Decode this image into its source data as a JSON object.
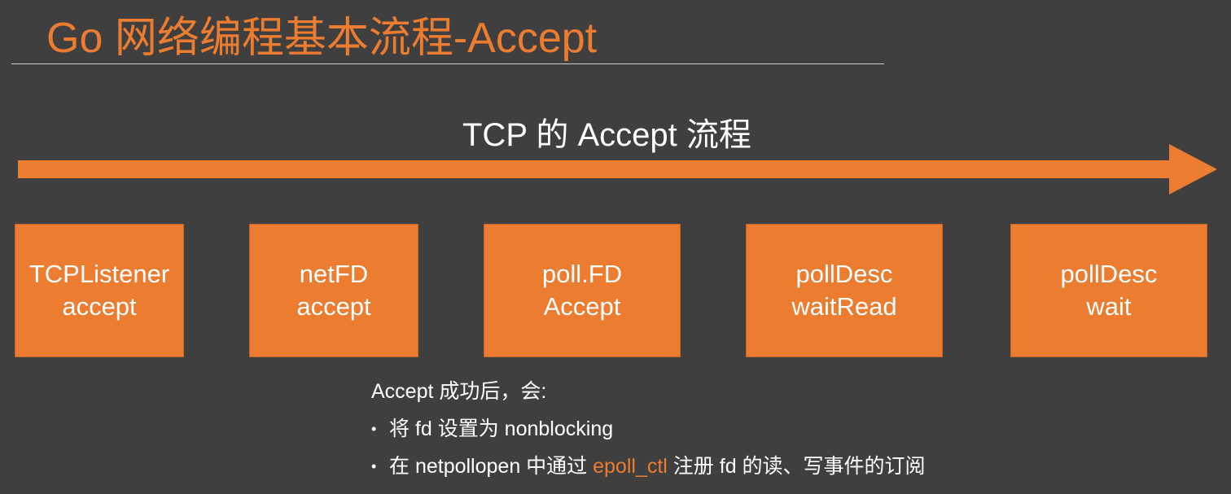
{
  "header": {
    "title": "Go 网络编程基本流程-Accept"
  },
  "flow": {
    "title": "TCP 的 Accept 流程",
    "steps": [
      {
        "line1": "TCPListener",
        "line2": "accept"
      },
      {
        "line1": "netFD",
        "line2": "accept"
      },
      {
        "line1": "poll.FD",
        "line2": "Accept"
      },
      {
        "line1": "pollDesc",
        "line2": "waitRead"
      },
      {
        "line1": "pollDesc",
        "line2": "wait"
      }
    ]
  },
  "notes": {
    "heading": "Accept 成功后，会:",
    "bullet_symbol": "•",
    "items": [
      {
        "text": "将 fd 设置为 nonblocking"
      },
      {
        "before": "在 netpollopen 中通过 ",
        "highlight": "epoll_ctl",
        "after": " 注册 fd 的读、写事件的订阅"
      }
    ]
  },
  "colors": {
    "background": "#3f3f3f",
    "accent": "#ec7c30",
    "text": "#ffffff",
    "rule": "#cfcfcf"
  },
  "icons": {
    "flow_arrow": "right-arrow-icon"
  }
}
